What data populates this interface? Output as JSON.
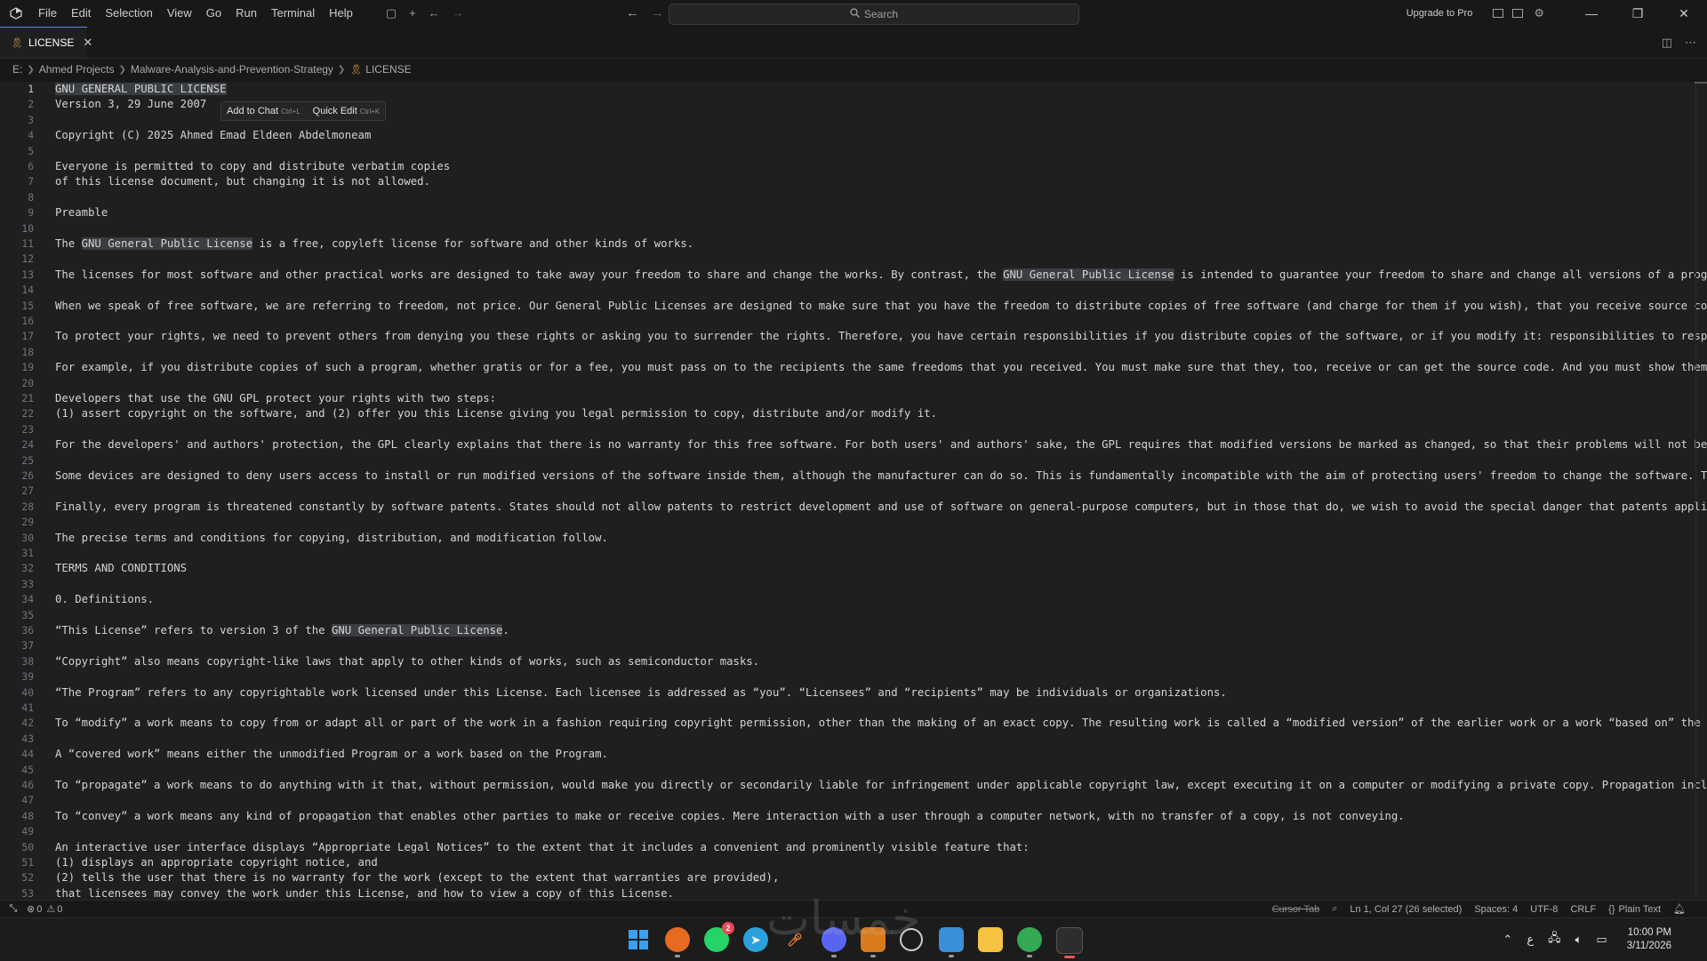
{
  "titlebar": {
    "menu": [
      "File",
      "Edit",
      "Selection",
      "View",
      "Go",
      "Run",
      "Terminal",
      "Help"
    ],
    "search_placeholder": "Search",
    "upgrade_label": "Upgrade to Pro"
  },
  "tab": {
    "label": "LICENSE"
  },
  "breadcrumb": {
    "drive": "E:",
    "parts": [
      "Ahmed Projects",
      "Malware-Analysis-and-Prevention-Strategy"
    ],
    "file": "LICENSE"
  },
  "inline_popup": {
    "add_to_chat": "Add to Chat",
    "add_to_chat_kbd": "Ctrl+L",
    "quick_edit": "Quick Edit",
    "quick_edit_kbd": "Ctrl+K"
  },
  "editor": {
    "active_line": 1,
    "highlight_term": "GNU General Public License",
    "lines": [
      "GNU GENERAL PUBLIC LICENSE",
      "Version 3, 29 June 2007",
      "",
      "Copyright (C) 2025 Ahmed Emad Eldeen Abdelmoneam",
      "",
      "Everyone is permitted to copy and distribute verbatim copies",
      "of this license document, but changing it is not allowed.",
      "",
      "Preamble",
      "",
      "The GNU General Public License is a free, copyleft license for software and other kinds of works.",
      "",
      "The licenses for most software and other practical works are designed to take away your freedom to share and change the works. By contrast, the GNU General Public License is intended to guarantee your freedom to share and change all versions of a program—to make s",
      "",
      "When we speak of free software, we are referring to freedom, not price. Our General Public Licenses are designed to make sure that you have the freedom to distribute copies of free software (and charge for them if you wish), that you receive source code or can ge",
      "",
      "To protect your rights, we need to prevent others from denying you these rights or asking you to surrender the rights. Therefore, you have certain responsibilities if you distribute copies of the software, or if you modify it: responsibilities to respect the free",
      "",
      "For example, if you distribute copies of such a program, whether gratis or for a fee, you must pass on to the recipients the same freedoms that you received. You must make sure that they, too, receive or can get the source code. And you must show them these terms",
      "",
      "Developers that use the GNU GPL protect your rights with two steps:",
      "(1) assert copyright on the software, and (2) offer you this License giving you legal permission to copy, distribute and/or modify it.",
      "",
      "For the developers' and authors' protection, the GPL clearly explains that there is no warranty for this free software. For both users' and authors' sake, the GPL requires that modified versions be marked as changed, so that their problems will not be attributed e",
      "",
      "Some devices are designed to deny users access to install or run modified versions of the software inside them, although the manufacturer can do so. This is fundamentally incompatible with the aim of protecting users' freedom to change the software. The systemati",
      "",
      "Finally, every program is threatened constantly by software patents. States should not allow patents to restrict development and use of software on general-purpose computers, but in those that do, we wish to avoid the special danger that patents applied to a free",
      "",
      "The precise terms and conditions for copying, distribution, and modification follow.",
      "",
      "TERMS AND CONDITIONS",
      "",
      "0. Definitions.",
      "",
      "“This License” refers to version 3 of the GNU General Public License.",
      "",
      "“Copyright” also means copyright-like laws that apply to other kinds of works, such as semiconductor masks.",
      "",
      "“The Program” refers to any copyrightable work licensed under this License. Each licensee is addressed as “you”. “Licensees” and “recipients” may be individuals or organizations.",
      "",
      "To “modify” a work means to copy from or adapt all or part of the work in a fashion requiring copyright permission, other than the making of an exact copy. The resulting work is called a “modified version” of the earlier work or a work “based on” the earlier work",
      "",
      "A “covered work” means either the unmodified Program or a work based on the Program.",
      "",
      "To “propagate” a work means to do anything with it that, without permission, would make you directly or secondarily liable for infringement under applicable copyright law, except executing it on a computer or modifying a private copy. Propagation includes copying",
      "",
      "To “convey” a work means any kind of propagation that enables other parties to make or receive copies. Mere interaction with a user through a computer network, with no transfer of a copy, is not conveying.",
      "",
      "An interactive user interface displays “Appropriate Legal Notices” to the extent that it includes a convenient and prominently visible feature that:",
      "(1) displays an appropriate copyright notice, and",
      "(2) tells the user that there is no warranty for the work (except to the extent that warranties are provided),",
      "that licensees may convey the work under this License, and how to view a copy of this License."
    ]
  },
  "statusbar": {
    "errors": "0",
    "warnings": "0",
    "cursor_tab": "Cursor Tab",
    "position": "Ln 1, Col 27 (26 selected)",
    "spaces": "Spaces: 4",
    "encoding": "UTF-8",
    "eol": "CRLF",
    "language": "Plain Text"
  },
  "taskbar": {
    "whatsapp_badge": "2",
    "time": "10:00 PM",
    "date": "3/11/2026",
    "lang": "ع"
  },
  "watermark": "خمسات",
  "colors": {
    "accent": "#4d8ae0",
    "editor_bg": "#1f1f1f",
    "chrome_bg": "#181818",
    "highlight": "#3a3d41",
    "badge": "#e74856"
  }
}
